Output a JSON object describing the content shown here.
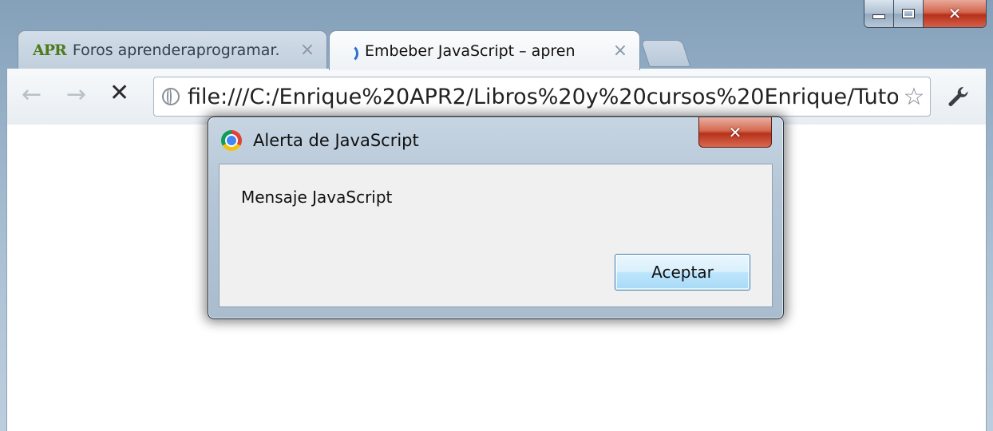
{
  "window": {
    "minimize_label": "",
    "maximize_label": "",
    "close_label": "✕"
  },
  "tabs": [
    {
      "favicon_text": "APR",
      "title": "Foros aprenderaprogramar.",
      "close": "×"
    },
    {
      "title": "Embeber JavaScript – apren",
      "close": "×"
    }
  ],
  "toolbar": {
    "back": "←",
    "forward": "→",
    "stop": "✕",
    "url": "file:///C:/Enrique%20APR2/Libros%20y%20cursos%20Enrique/Tuto",
    "star": "☆"
  },
  "dialog": {
    "title": "Alerta de JavaScript",
    "close": "✕",
    "message": "Mensaje JavaScript",
    "ok_label": "Aceptar"
  }
}
